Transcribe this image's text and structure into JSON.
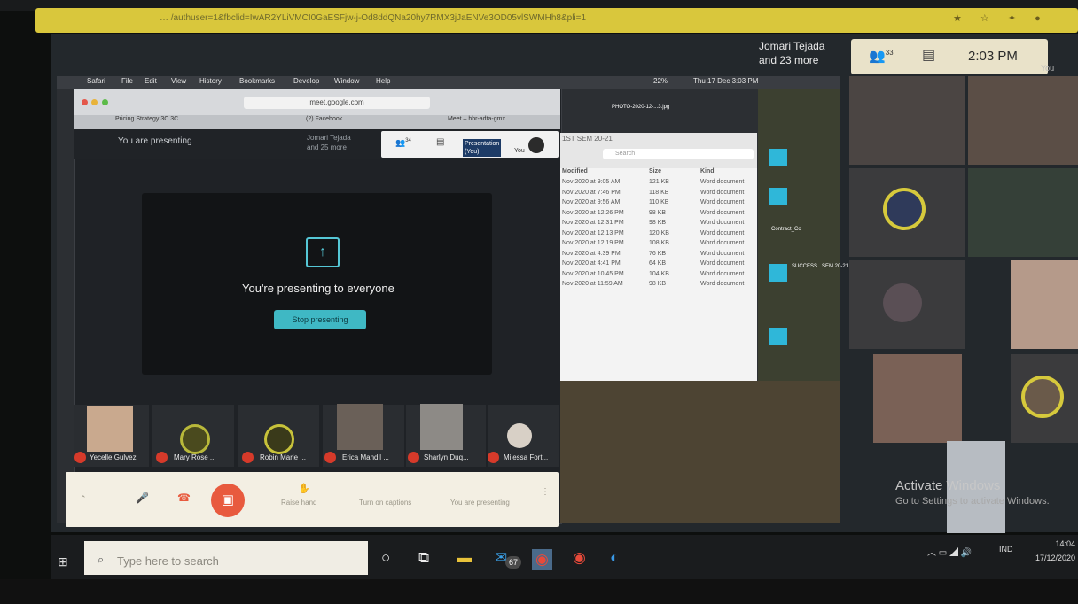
{
  "browser": {
    "url": "… /authuser=1&fbclid=IwAR2YLiVMCI0GaESFjw-j-Od8ddQNa20hy7RMX3jJaENVe3OD05vlSWMHh8&pli=1"
  },
  "meet": {
    "participant_label": "Jomari Tejada",
    "participant_more": "and 23 more",
    "people_count": "33",
    "time": "2:03 PM",
    "you": "You"
  },
  "mac": {
    "menu": [
      "Safari",
      "File",
      "Edit",
      "View",
      "History",
      "Bookmarks",
      "Develop",
      "Window",
      "Help"
    ],
    "status_date": "Thu 17 Dec  3:03 PM",
    "battery": "22%",
    "safari_url": "meet.google.com",
    "tabs": [
      "Pricing Strategy 3C 3C",
      "(2) Facebook",
      "Meet – hbr-adta-gmx"
    ]
  },
  "inner_meet": {
    "presenting_label": "You are presenting",
    "name": "Jomari Tejada",
    "more": "and 25 more",
    "count": "34",
    "presentation_label": "Presentation",
    "presentation_sub": "(You)",
    "you": "You",
    "present_title": "You're presenting to everyone",
    "stop_button": "Stop presenting",
    "participants": [
      "Yecelle Gulvez",
      "Mary Rose ...",
      "Robin Marie ...",
      "Erica Mandil ...",
      "Sharlyn Duq...",
      "Milessa Fort..."
    ],
    "controls": [
      "Raise hand",
      "Turn on captions",
      "You are presenting"
    ]
  },
  "finder": {
    "folder": "1ST SEM 20-21",
    "search_placeholder": "Search",
    "columns": [
      "Modified",
      "Size",
      "Kind"
    ],
    "rows": [
      {
        "modified": "Nov 2020 at 9:05 AM",
        "size": "121 KB",
        "kind": "Word document"
      },
      {
        "modified": "Nov 2020 at 7:46 PM",
        "size": "118 KB",
        "kind": "Word document"
      },
      {
        "modified": "Nov 2020 at 9:56 AM",
        "size": "110 KB",
        "kind": "Word document"
      },
      {
        "modified": "Nov 2020 at 12:26 PM",
        "size": "98 KB",
        "kind": "Word document"
      },
      {
        "modified": "Nov 2020 at 12:31 PM",
        "size": "98 KB",
        "kind": "Word document"
      },
      {
        "modified": "Nov 2020 at 12:13 PM",
        "size": "120 KB",
        "kind": "Word document"
      },
      {
        "modified": "Nov 2020 at 12:19 PM",
        "size": "108 KB",
        "kind": "Word document"
      },
      {
        "modified": "Nov 2020 at 4:39 PM",
        "size": "76 KB",
        "kind": "Word document"
      },
      {
        "modified": "Nov 2020 at 4:41 PM",
        "size": "64 KB",
        "kind": "Word document"
      },
      {
        "modified": "Nov 2020 at 10:45 PM",
        "size": "104 KB",
        "kind": "Word document"
      },
      {
        "modified": "Nov 2020 at 11:59 AM",
        "size": "98 KB",
        "kind": "Word document"
      }
    ],
    "desktop_files": [
      "PHOTO-2020-12-...3.jpg",
      "Contract_Co",
      "SUCCESS...SEM 20-21"
    ]
  },
  "windows": {
    "activate_title": "Activate Windows",
    "activate_sub": "Go to Settings to activate Windows.",
    "search_placeholder": "Type here to search",
    "mail_badge": "67",
    "lang": "IND",
    "tray_time": "14:04",
    "tray_date": "17/12/2020"
  },
  "colors": {
    "meet_accent": "#3fb8c4",
    "end_call": "#e85a3e",
    "mic_off": "#d63a2a",
    "url_bar": "#d9c73c"
  }
}
